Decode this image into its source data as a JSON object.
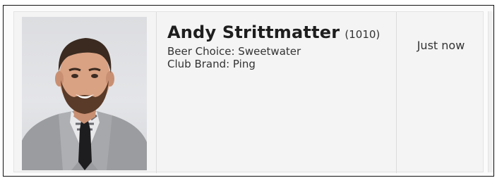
{
  "member": {
    "name": "Andy Strittmatter",
    "id": "(1010)",
    "beer_choice": "Beer Choice: Sweetwater",
    "club_brand": "Club Brand: Ping",
    "timestamp": "Just now"
  },
  "icons": {
    "photo": "member-photo"
  },
  "colors": {
    "card_background": "#f4f4f4",
    "divider": "#dcdcdc",
    "name_text": "#1e1e1e",
    "body_text": "#333333"
  }
}
